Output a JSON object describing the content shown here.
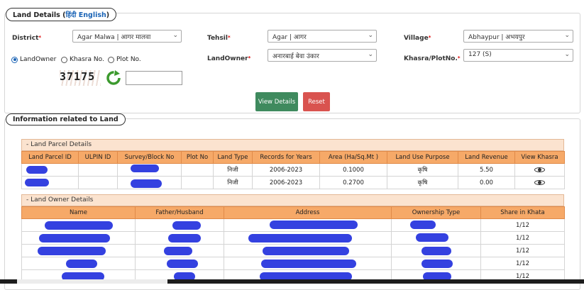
{
  "land_details": {
    "title": "Land Details",
    "lang_hi": "हिंदी",
    "lang_en": "English"
  },
  "form": {
    "district_label": "District",
    "district_value": "Agar Malwa | आगर मालवा",
    "tehsil_label": "Tehsil",
    "tehsil_value": "Agar | आगर",
    "village_label": "Village",
    "village_value": "Abhaypur | अभयपुर",
    "landowner_label": "LandOwner",
    "landowner_value": "अनारबाई बेवा उंकार",
    "khasra_label": "Khasra/PlotNo.",
    "khasra_value": "127 (S)",
    "radio_landowner": "LandOwner",
    "radio_khasra": "Khasra No.",
    "radio_plot": "Plot No.",
    "captcha_text": "37175",
    "view_label": "View Details",
    "reset_label": "Reset",
    "view_color": "#3f8a5e",
    "reset_color": "#d9534f"
  },
  "info": {
    "title": "Information related to Land"
  },
  "parcel": {
    "heading": "- Land Parcel Details",
    "columns": [
      "Land Parcel ID",
      "ULPIN ID",
      "Survey/Block No",
      "Plot No",
      "Land Type",
      "Records for Years",
      "Area (Ha/Sq.Mt )",
      "Land Use Purpose",
      "Land Revenue",
      "View Khasra"
    ],
    "rows": [
      {
        "land_type": "निजी",
        "years": "2006-2023",
        "area": "0.1000",
        "purpose": "कृषि",
        "revenue": "5.50"
      },
      {
        "land_type": "निजी",
        "years": "2006-2023",
        "area": "0.2700",
        "purpose": "कृषि",
        "revenue": "0.00"
      }
    ]
  },
  "owner": {
    "heading": "- Land Owner Details",
    "columns": [
      "Name",
      "Father/Husband",
      "Address",
      "Ownership Type",
      "Share in Khata"
    ],
    "rows": [
      {
        "share": "1/12"
      },
      {
        "share": "1/12"
      },
      {
        "share": "1/12"
      },
      {
        "share": "1/12"
      },
      {
        "share": "1/12"
      }
    ]
  },
  "colors": {
    "header_orange": "#f6a968",
    "panel_peach": "#fbe3cf",
    "redaction_blue": "#3441e0",
    "accent_blue": "#1a63b5"
  }
}
